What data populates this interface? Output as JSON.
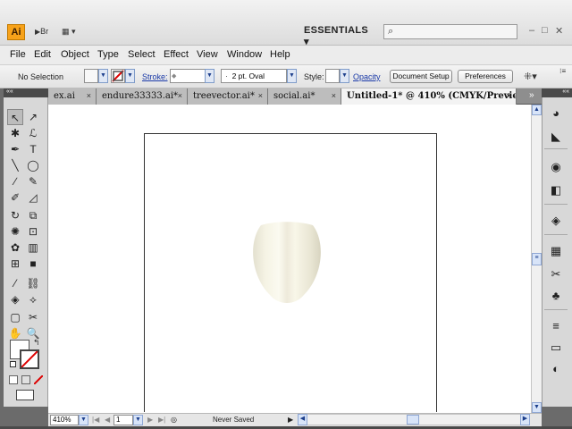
{
  "app": {
    "logo": "Ai",
    "bridge_label": "Br",
    "workspace": "ESSENTIALS",
    "search_placeholder": "",
    "minimize": "–",
    "maximize": "□",
    "close": "✕"
  },
  "menu": [
    "File",
    "Edit",
    "Object",
    "Type",
    "Select",
    "Effect",
    "View",
    "Window",
    "Help"
  ],
  "control": {
    "selection": "No Selection",
    "stroke_label": "Stroke:",
    "brush": "2 pt. Oval",
    "brush_dot": "·",
    "style_label": "Style:",
    "opacity_label": "Opacity",
    "doc_setup": "Document Setup",
    "preferences": "Preferences"
  },
  "tabs": [
    {
      "label": "ex.ai",
      "close": "×"
    },
    {
      "label": "endure33333.ai*",
      "close": "×"
    },
    {
      "label": "treevector.ai*",
      "close": "×"
    },
    {
      "label": "social.ai*",
      "close": "×"
    },
    {
      "label": "Untitled-1* @ 410% (CMYK/Preview)",
      "close": "×"
    }
  ],
  "tab_overflow": "»",
  "panel_collapse": "««",
  "status": {
    "zoom": "410%",
    "page": "1",
    "state": "Never Saved"
  },
  "colors": {
    "accent": "#f7a21a",
    "link": "#1a3aa8"
  },
  "icons": {
    "tools": [
      "selection-tool",
      "direct-selection-tool",
      "magic-wand-tool",
      "lasso-tool",
      "pen-tool",
      "type-tool",
      "line-tool",
      "ellipse-tool",
      "paintbrush-tool",
      "pencil-tool",
      "blob-brush-tool",
      "eraser-tool",
      "rotate-tool",
      "scale-tool",
      "warp-tool",
      "free-transform-tool",
      "symbol-sprayer-tool",
      "column-graph-tool",
      "mesh-tool",
      "gradient-tool",
      "eyedropper-tool",
      "blend-tool",
      "live-paint-tool",
      "live-paint-selection-tool",
      "artboard-tool",
      "slice-tool",
      "hand-tool",
      "zoom-tool"
    ],
    "right_panel": [
      "color-icon",
      "color-guide-icon",
      "appearance-icon",
      "graphic-styles-icon",
      "layers-icon",
      "swatches-icon",
      "brushes-icon",
      "symbols-icon",
      "stroke-icon",
      "gradient-icon",
      "transparency-icon"
    ]
  }
}
